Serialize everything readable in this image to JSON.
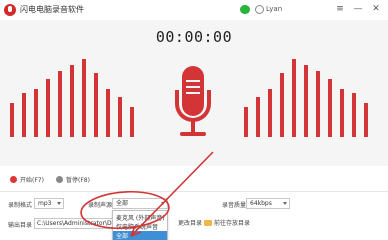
{
  "app": {
    "title": "闪电电脑录音软件",
    "user_name": "Lyan",
    "icons": [
      "app-logo-icon",
      "wechat-icon",
      "user-icon",
      "menu-icon",
      "minimize-icon",
      "close-icon"
    ]
  },
  "window_buttons": {
    "menu": "≡",
    "minimize": "—",
    "close": "✕"
  },
  "recorder": {
    "timer": "00:00:00",
    "accent_color": "#d33435"
  },
  "controls": {
    "start_label": "开始(F7)",
    "pause_label": "暂停(F8)"
  },
  "settings": {
    "format_label": "录制格式",
    "format_value": "mp3",
    "source_label": "录制声源",
    "source_value": "全部",
    "quality_label": "录音质量",
    "quality_value": "64kbps",
    "output_label": "输出目录",
    "output_path": "C:\\Users\\Administrator\\Desktop\\",
    "change_dir_label": "更改目录",
    "open_dir_label": "前往存放目录"
  },
  "dropdown": {
    "options": [
      "麦克风 (外部声音)",
      "仅电脑系统声音",
      "全部"
    ],
    "selected_index": 2
  },
  "annotation": {
    "color": "#d33435"
  }
}
